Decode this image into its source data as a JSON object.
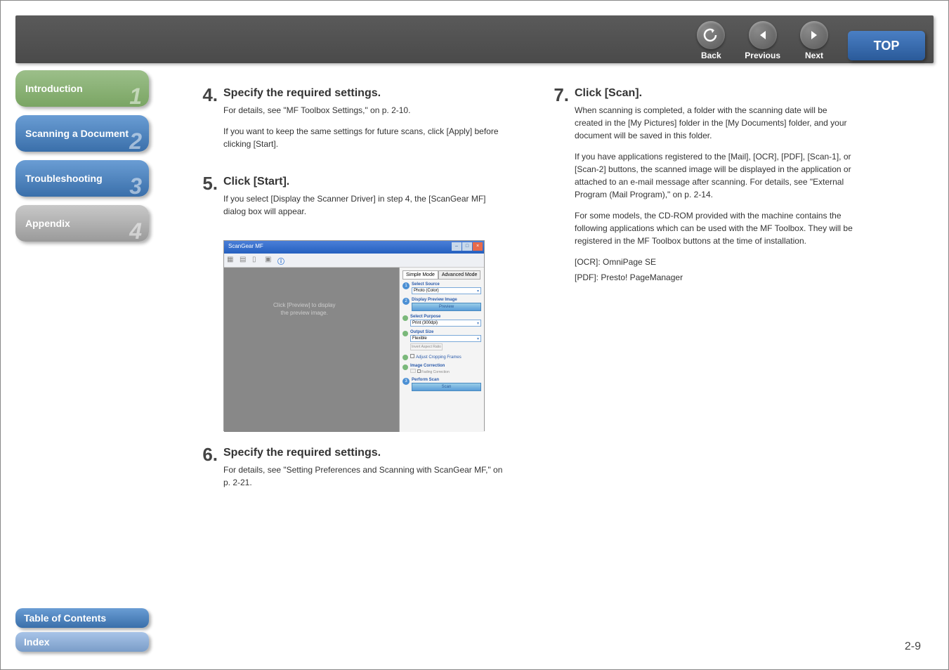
{
  "nav": {
    "back": "Back",
    "previous": "Previous",
    "next": "Next",
    "top": "TOP"
  },
  "sidebar": {
    "intro": "Introduction",
    "intro_num": "1",
    "scan": "Scanning a Document",
    "scan_num": "2",
    "trouble": "Troubleshooting",
    "trouble_num": "3",
    "appendix": "Appendix",
    "appendix_num": "4",
    "toc": "Table of Contents",
    "index": "Index"
  },
  "steps": {
    "s4": {
      "num": "4.",
      "title": "Specify the required settings.",
      "p1": "For details, see \"MF Toolbox Settings,\" on p. 2-10.",
      "p2": "If you want to keep the same settings for future scans, click [Apply] before clicking [Start]."
    },
    "s5": {
      "num": "5.",
      "title": "Click [Start].",
      "p1": "If you select [Display the Scanner Driver] in step 4, the [ScanGear MF] dialog box will appear."
    },
    "s6": {
      "num": "6.",
      "title": "Specify the required settings.",
      "p1": "For details, see \"Setting Preferences and Scanning with ScanGear MF,\" on p. 2-21."
    },
    "s7": {
      "num": "7.",
      "title": "Click [Scan].",
      "p1": "When scanning is completed, a folder with the scanning date will be created in the [My Pictures] folder in the [My Documents] folder, and your document will be saved in this folder.",
      "p2": "If you have applications registered to the [Mail], [OCR], [PDF], [Scan-1], or [Scan-2] buttons, the scanned image will be displayed in the application or attached to an e-mail message after scanning. For details, see \"External Program (Mail Program),\" on p. 2-14.",
      "p3": "For some models, the CD-ROM provided with the machine contains the following applications which can be used with the MF Toolbox. They will be registered in the MF Toolbox buttons at the time of installation.",
      "p4": "[OCR]: OmniPage SE",
      "p5": "[PDF]: Presto! PageManager"
    }
  },
  "screenshot": {
    "title": "ScanGear MF",
    "preview_hint_l1": "Click [Preview] to display",
    "preview_hint_l2": "the preview image.",
    "tab1": "Simple Mode",
    "tab2": "Advanced Mode",
    "select_source": "Select Source",
    "select_source_val": "Photo (Color)",
    "display_preview": "Display Preview Image",
    "preview_btn": "Preview",
    "select_purpose": "Select Purpose",
    "select_purpose_val": "Print (300dpi)",
    "output_size": "Output Size",
    "output_size_val": "Flexible",
    "invert_aspect": "Invert Aspect Ratio",
    "adjust_crop": "Adjust Cropping Frames",
    "image_correction": "Image Correction",
    "fading": "Fading Correction",
    "perform_scan": "Perform Scan",
    "scan_btn": "Scan"
  },
  "page_num": "2-9"
}
